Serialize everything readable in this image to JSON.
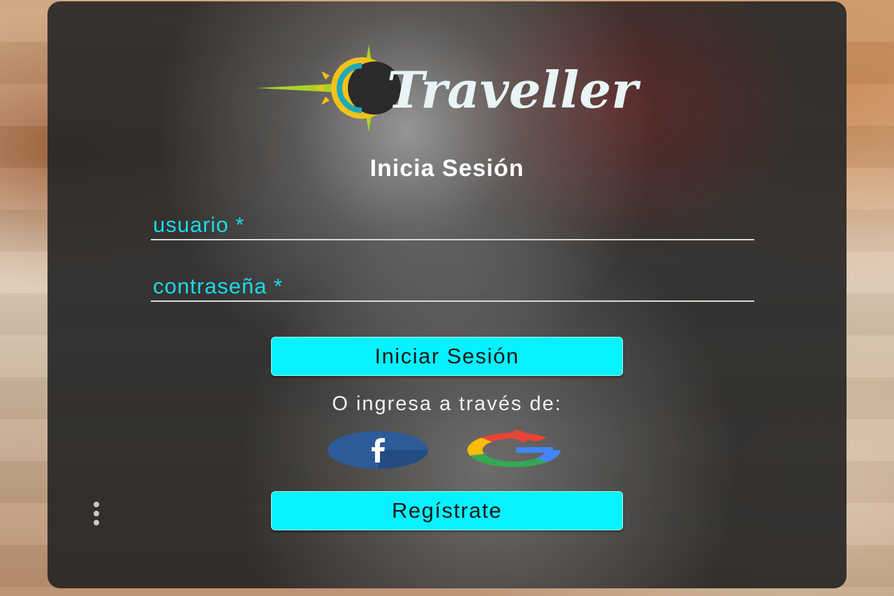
{
  "app": {
    "brand": "Traveller"
  },
  "login": {
    "title": "Inicia Sesión",
    "username_placeholder": "usuario *",
    "password_placeholder": "contraseña *",
    "submit_label": "Iniciar Sesión",
    "alt_login_text": "O ingresa a través de:",
    "register_label": "Regístrate"
  },
  "social": {
    "facebook_icon": "facebook-icon",
    "google_icon": "google-icon"
  },
  "colors": {
    "accent_cyan": "#06f2ff",
    "placeholder_cyan": "#19d9ea",
    "card_bg": "#2a2a2a",
    "facebook_blue": "#2d5b9a"
  }
}
